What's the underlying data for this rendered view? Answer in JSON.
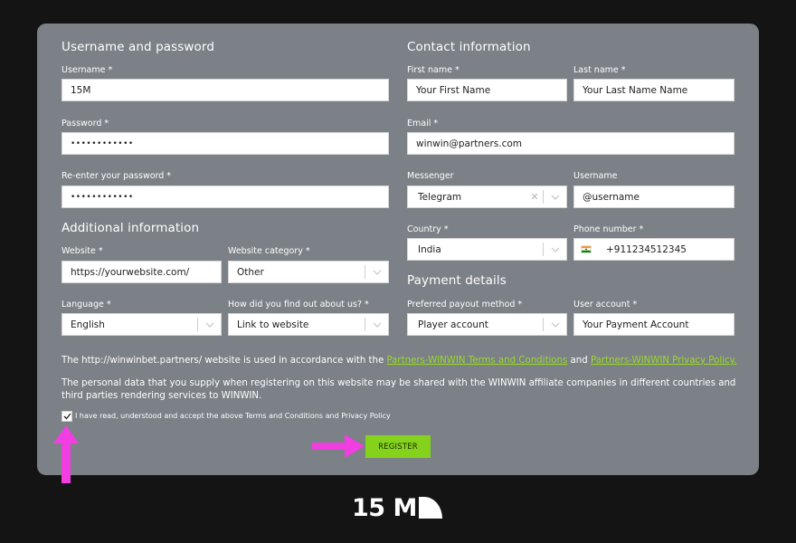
{
  "sections": {
    "username_password": "Username and password",
    "contact": "Contact information",
    "additional": "Additional information",
    "payment": "Payment details"
  },
  "fields": {
    "username": {
      "label": "Username *",
      "value": "15M"
    },
    "password": {
      "label": "Password *",
      "value": "••••••••••••"
    },
    "reenter_password": {
      "label": "Re-enter your password *",
      "value": "••••••••••••"
    },
    "first_name": {
      "label": "First name *",
      "value": "Your First Name"
    },
    "last_name": {
      "label": "Last name *",
      "value": "Your Last Name Name"
    },
    "email": {
      "label": "Email *",
      "value": "winwin@partners.com"
    },
    "messenger": {
      "label": "Messenger",
      "value": "Telegram"
    },
    "messenger_username": {
      "label": "Username",
      "value": "@username"
    },
    "country": {
      "label": "Country *",
      "value": "India"
    },
    "phone": {
      "label": "Phone number *",
      "value": "+911234512345"
    },
    "website": {
      "label": "Website *",
      "value": "https://yourwebsite.com/"
    },
    "website_category": {
      "label": "Website category *",
      "value": "Other"
    },
    "language": {
      "label": "Language *",
      "value": "English"
    },
    "found_us": {
      "label": "How did you find out about us? *",
      "value": "Link to website"
    },
    "payout_method": {
      "label": "Preferred payout method *",
      "value": "Player account"
    },
    "user_account": {
      "label": "User account *",
      "value": "Your Payment Account"
    }
  },
  "terms": {
    "line1_prefix": "The http://winwinbet.partners/ website is used in accordance with the ",
    "terms_link": "Partners-WINWIN Terms and Conditions",
    "and": " and ",
    "privacy_link": "Partners-WINWIN Privacy Policy.",
    "line2": "The personal data that you supply when registering on this website may be shared with the WINWIN affiliate companies in different countries and third parties rendering services to WINWIN.",
    "checkbox_label": "I have read, understood and accept the above Terms and Conditions and Privacy Policy",
    "checkbox_checked": true
  },
  "register_label": "REGISTER",
  "brand_logo": "15 M",
  "colors": {
    "background": "#141414",
    "card": "#7b8186",
    "accent_green": "#84d21b",
    "link_green": "#9bd92b",
    "arrow_magenta": "#f03ee0"
  },
  "icons": {
    "flag": "india-flag-icon",
    "chevron": "chevron-down-icon",
    "clear": "clear-icon",
    "check": "checkmark-icon",
    "arrow_up": "arrow-up-icon",
    "arrow_right": "arrow-right-icon"
  }
}
